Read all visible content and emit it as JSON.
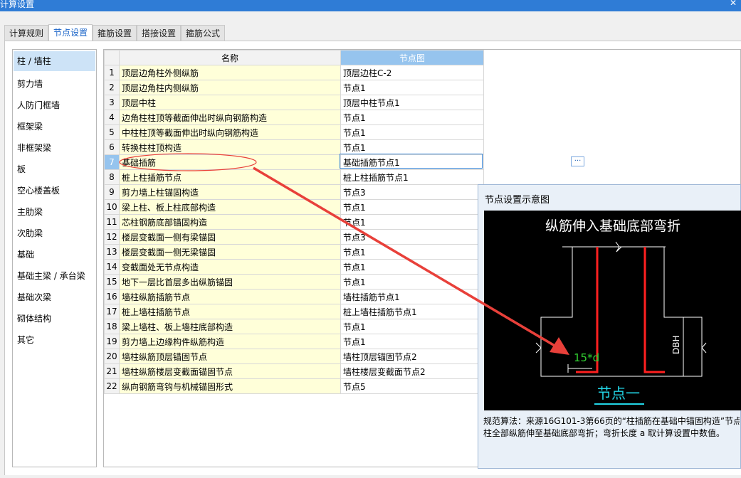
{
  "window": {
    "title": "计算设置"
  },
  "tabs": [
    "计算规则",
    "节点设置",
    "箍筋设置",
    "搭接设置",
    "箍筋公式"
  ],
  "sidebar": {
    "items": [
      "柱 / 墙柱",
      "剪力墙",
      "人防门框墙",
      "框架梁",
      "非框架梁",
      "板",
      "空心楼盖板",
      "主肋梁",
      "次肋梁",
      "基础",
      "基础主梁 / 承台梁",
      "基础次梁",
      "砌体结构",
      "其它"
    ]
  },
  "grid": {
    "headers": {
      "name": "名称",
      "node": "节点图"
    },
    "rows": [
      {
        "num": "1",
        "name": "顶层边角柱外侧纵筋",
        "node": "顶层边柱C-2"
      },
      {
        "num": "2",
        "name": "顶层边角柱内侧纵筋",
        "node": "节点1"
      },
      {
        "num": "3",
        "name": "顶层中柱",
        "node": "顶层中柱节点1"
      },
      {
        "num": "4",
        "name": "边角柱柱顶等截面伸出时纵向钢筋构造",
        "node": "节点1"
      },
      {
        "num": "5",
        "name": "中柱柱顶等截面伸出时纵向钢筋构造",
        "node": "节点1"
      },
      {
        "num": "6",
        "name": "转换柱柱顶构造",
        "node": "节点1"
      },
      {
        "num": "7",
        "name": "基础插筋",
        "node": "基础插筋节点1"
      },
      {
        "num": "8",
        "name": "桩上柱插筋节点",
        "node": "桩上柱插筋节点1"
      },
      {
        "num": "9",
        "name": "剪力墙上柱锚固构造",
        "node": "节点3"
      },
      {
        "num": "10",
        "name": "梁上柱、板上柱底部构造",
        "node": "节点1"
      },
      {
        "num": "11",
        "name": "芯柱钢筋底部锚固构造",
        "node": "节点1"
      },
      {
        "num": "12",
        "name": "楼层变截面一侧有梁锚固",
        "node": "节点3"
      },
      {
        "num": "13",
        "name": "楼层变截面一侧无梁锚固",
        "node": "节点1"
      },
      {
        "num": "14",
        "name": "变截面处无节点构造",
        "node": "节点1"
      },
      {
        "num": "15",
        "name": "地下一层比首层多出纵筋锚固",
        "node": "节点1"
      },
      {
        "num": "16",
        "name": "墙柱纵筋插筋节点",
        "node": "墙柱插筋节点1"
      },
      {
        "num": "17",
        "name": "桩上墙柱插筋节点",
        "node": "桩上墙柱插筋节点1"
      },
      {
        "num": "18",
        "name": "梁上墙柱、板上墙柱底部构造",
        "node": "节点1"
      },
      {
        "num": "19",
        "name": "剪力墙上边缘构件纵筋构造",
        "node": "节点1"
      },
      {
        "num": "20",
        "name": "墙柱纵筋顶层锚固节点",
        "node": "墙柱顶层锚固节点2"
      },
      {
        "num": "21",
        "name": "墙柱纵筋楼层变截面锚固节点",
        "node": "墙柱楼层变截面节点2"
      },
      {
        "num": "22",
        "name": "纵向钢筋弯钩与机械锚固形式",
        "node": "节点5"
      }
    ],
    "selected_row": 7,
    "ellipsis": "···"
  },
  "dialog": {
    "title": "节点设置示意图",
    "diagram": {
      "caption": "纵筋伸入基础底部弯折",
      "anchor_label": "15*d",
      "height_label": "DBH",
      "node_name": "节点一",
      "colors": {
        "rebar": "#ff2020",
        "outline": "#ffffff",
        "label": "#32d332",
        "node": "#22d5e6"
      }
    },
    "description": [
      "规范算法：来源16G101-3第66页的“柱插筋在基础中锚固构造”节点",
      "柱全部纵筋伸至基础底部弯折；弯折长度 a 取计算设置中数值。"
    ]
  },
  "annotation_color": "#e8403a"
}
